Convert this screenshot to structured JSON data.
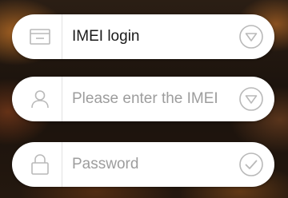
{
  "login_type": {
    "label": "IMEI login",
    "lead_icon": "monitor-icon",
    "trail_icon": "dropdown-triangle-icon"
  },
  "imei_field": {
    "placeholder": "Please enter the IMEI",
    "lead_icon": "user-icon",
    "trail_icon": "dropdown-triangle-icon"
  },
  "password_field": {
    "placeholder": "Password",
    "lead_icon": "lock-icon",
    "trail_icon": "check-circle-icon"
  },
  "colors": {
    "field_bg": "#ffffff",
    "icon": "#b9b9b9",
    "placeholder": "#9d9d9d",
    "value_text": "#1a1a1a"
  }
}
